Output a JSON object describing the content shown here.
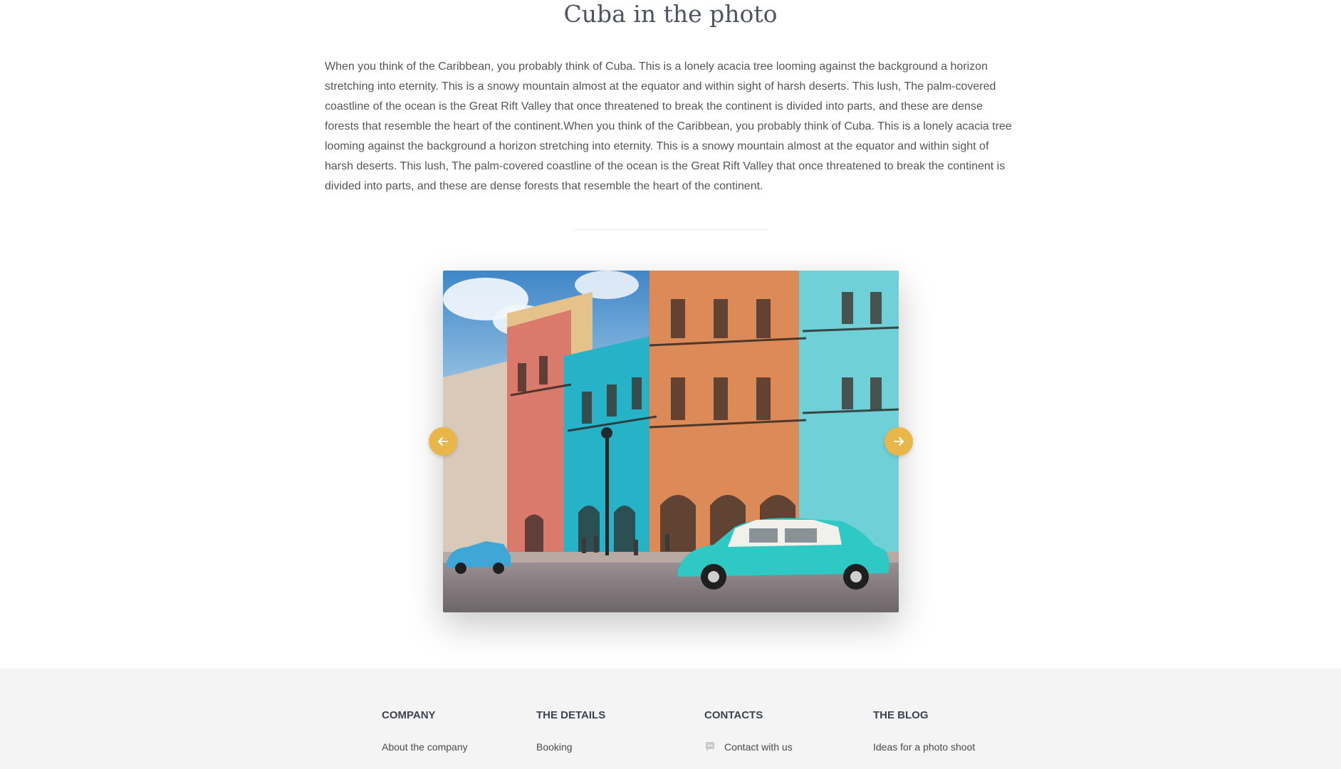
{
  "article": {
    "title": "Cuba in the photo",
    "body": "When you think of the Caribbean, you probably think of Cuba. This is a lonely acacia tree looming against the background a horizon stretching into eternity. This is a snowy mountain almost at the equator and within sight of harsh deserts. This lush, The palm-covered coastline of the ocean is the Great Rift Valley that once threatened to break the continent is divided into parts, and these are dense forests that resemble the heart of the continent.When you think of the Caribbean, you probably think of Cuba. This is a lonely acacia tree looming against the background a horizon stretching into eternity. This is a snowy mountain almost at the equator and within sight of harsh deserts. This lush, The palm-covered coastline of the ocean is the Great Rift Valley that once threatened to break the continent is divided into parts, and these are dense forests that resemble the heart of the continent."
  },
  "slider": {
    "photo_icon": "havana-street-photo",
    "prev_icon": "arrow-left-icon",
    "next_icon": "arrow-right-icon",
    "accent_color": "#e9b64a"
  },
  "footer": {
    "company": {
      "heading": "COMPANY",
      "links": [
        "About the company"
      ]
    },
    "details": {
      "heading": "THE DETAILS",
      "links": [
        "Booking"
      ]
    },
    "contacts": {
      "heading": "CONTACTS",
      "links": [
        {
          "icon": "chat-bubble-icon",
          "label": "Contact with us"
        }
      ]
    },
    "blog": {
      "heading": "THE BLOG",
      "links": [
        "Ideas for a photo shoot"
      ]
    }
  }
}
